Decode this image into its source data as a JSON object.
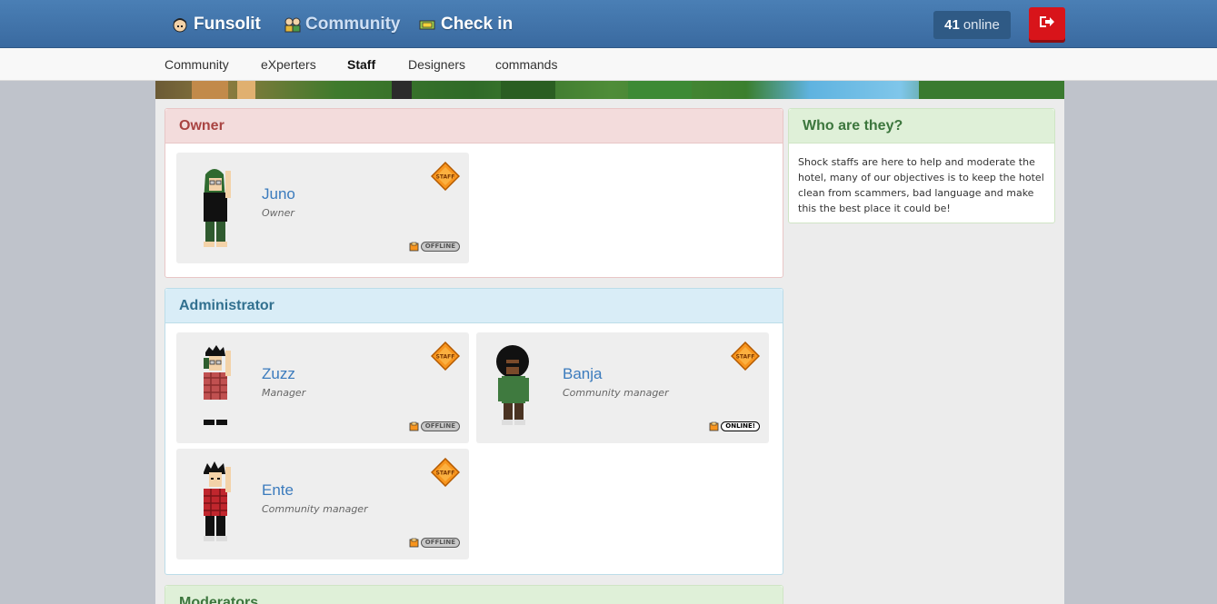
{
  "topbar": {
    "brand": "Funsolit",
    "community": "Community",
    "checkin": "Check in",
    "online_count": "41",
    "online_label": "online"
  },
  "subnav": {
    "items": [
      "Community",
      "eXperters",
      "Staff",
      "Designers",
      "commands"
    ],
    "active": "Staff"
  },
  "sections": {
    "owner": {
      "title": "Owner",
      "members": [
        {
          "name": "Juno",
          "rank": "Owner",
          "status": "OFFLINE"
        }
      ]
    },
    "admin": {
      "title": "Administrator",
      "members": [
        {
          "name": "Zuzz",
          "rank": "Manager",
          "status": "OFFLINE"
        },
        {
          "name": "Banja",
          "rank": "Community manager",
          "status": "ONLINE!"
        },
        {
          "name": "Ente",
          "rank": "Community manager",
          "status": "OFFLINE"
        }
      ]
    },
    "moderators": {
      "title": "Moderators"
    }
  },
  "badge_text": "STAFF",
  "who": {
    "title": "Who are they?",
    "text": "Shock staffs are here to help and moderate the hotel, many of our objectives is to keep the hotel clean from scammers, bad language and make this the best place it could be!"
  },
  "colors": {
    "topbar": "#3f72a9",
    "owner_head": "#f3dcdc",
    "admin_head": "#d9edf7",
    "who_head": "#dff0d8",
    "logout": "#d8141a"
  }
}
